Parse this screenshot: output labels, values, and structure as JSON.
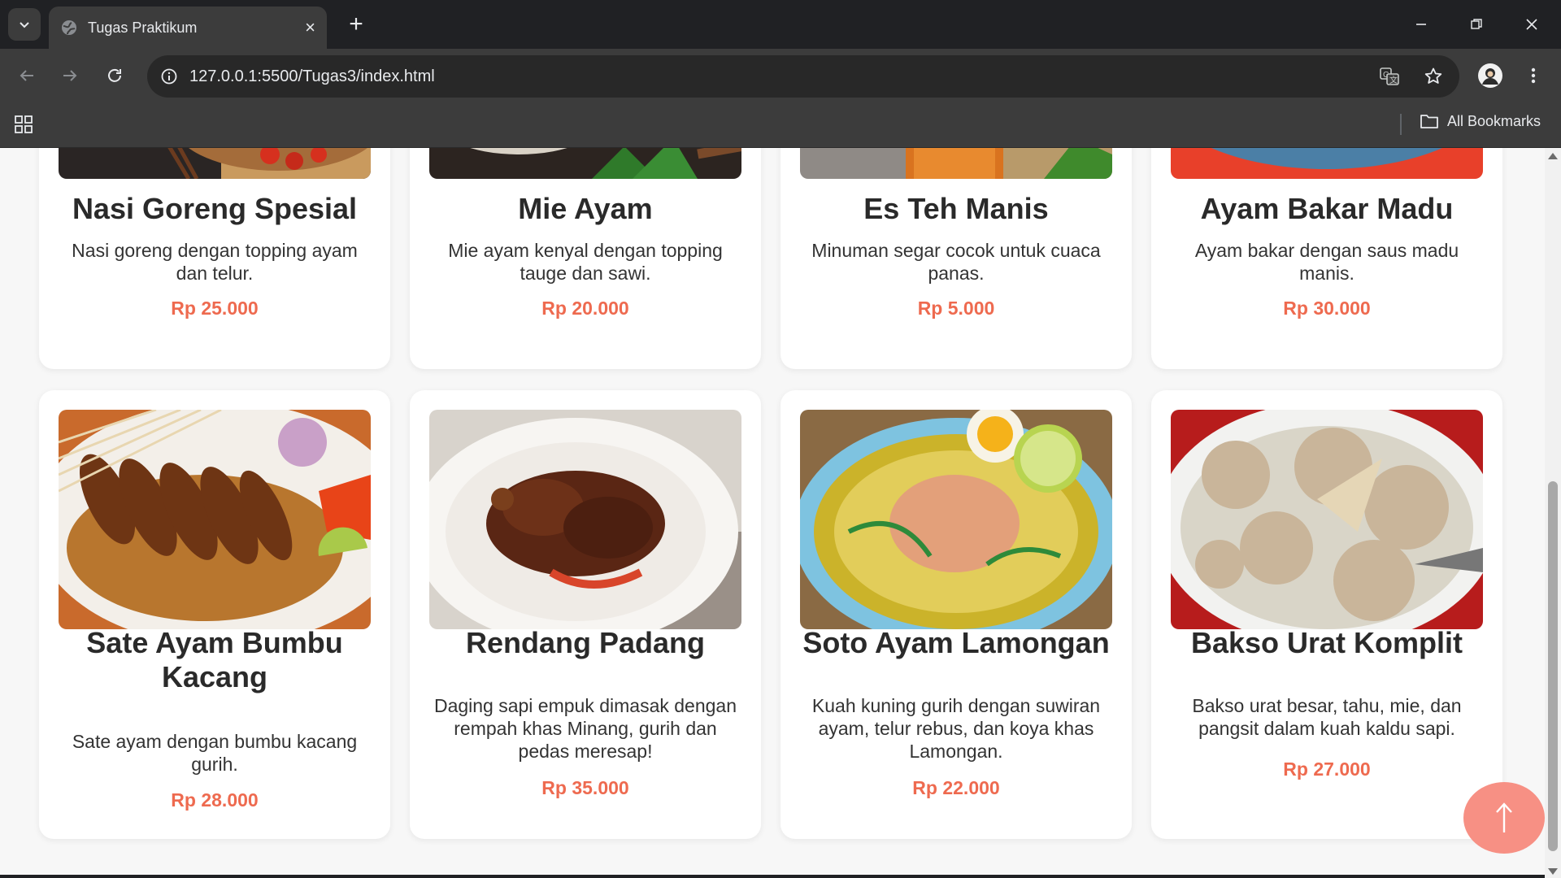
{
  "browser": {
    "tab_title": "Tugas Praktikum",
    "url": "127.0.0.1:5500/Tugas3/index.html",
    "all_bookmarks": "All Bookmarks"
  },
  "menu": {
    "top_row": [
      {
        "title": "Nasi Goreng Spesial",
        "description": "Nasi goreng dengan topping ayam dan telur.",
        "price": "Rp 25.000"
      },
      {
        "title": "Mie Ayam",
        "description": "Mie ayam kenyal dengan topping tauge dan sawi.",
        "price": "Rp 20.000"
      },
      {
        "title": "Es Teh Manis",
        "description": "Minuman segar cocok untuk cuaca panas.",
        "price": "Rp 5.000"
      },
      {
        "title": "Ayam Bakar Madu",
        "description": "Ayam bakar dengan saus madu manis.",
        "price": "Rp 30.000"
      }
    ],
    "bottom_row": [
      {
        "title": "Sate Ayam Bumbu Kacang",
        "description": "Sate ayam dengan bumbu kacang gurih.",
        "price": "Rp 28.000"
      },
      {
        "title": "Rendang Padang",
        "description": "Daging sapi empuk dimasak dengan rempah khas Minang, gurih dan pedas meresap!",
        "price": "Rp 35.000"
      },
      {
        "title": "Soto Ayam Lamongan",
        "description": "Kuah kuning gurih dengan suwiran ayam, telur rebus, dan koya khas Lamongan.",
        "price": "Rp 22.000"
      },
      {
        "title": "Bakso Urat Komplit",
        "description": "Bakso urat besar, tahu, mie, dan pangsit dalam kuah kaldu sapi.",
        "price": "Rp 27.000"
      }
    ]
  },
  "scroll_top_icon": "arrow-up-icon",
  "colors": {
    "price": "#ee6a4f",
    "scroll_top_button": "#f79084"
  }
}
